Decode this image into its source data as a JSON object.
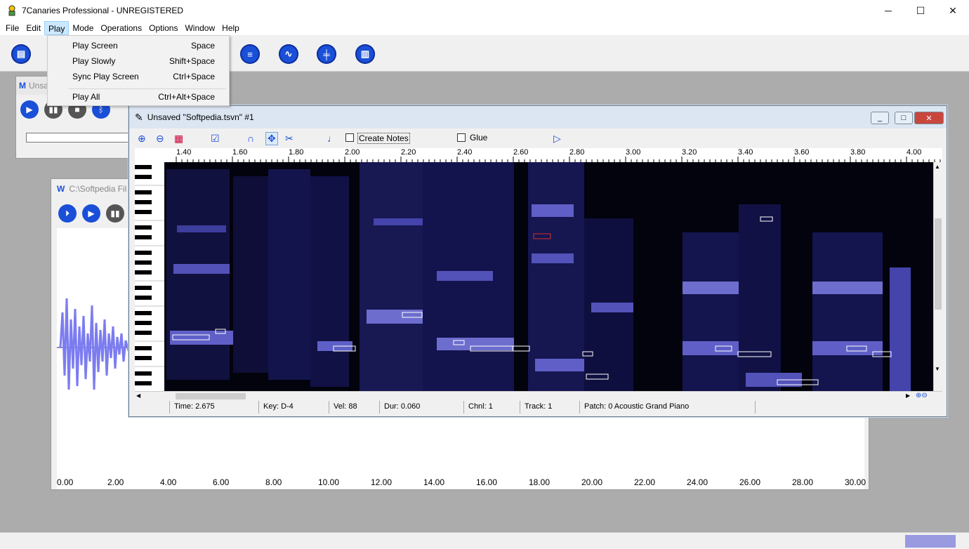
{
  "app": {
    "title": "7Canaries Professional - UNREGISTERED",
    "minimize": "─",
    "maximize": "☐",
    "close": "✕"
  },
  "menu": [
    "File",
    "Edit",
    "Play",
    "Mode",
    "Operations",
    "Options",
    "Window",
    "Help"
  ],
  "play_menu": {
    "items": [
      {
        "label": "Play Screen",
        "shortcut": "Space"
      },
      {
        "label": "Play Slowly",
        "shortcut": "Shift+Space"
      },
      {
        "label": "Sync Play Screen",
        "shortcut": "Ctrl+Space"
      },
      {
        "label": "Play All",
        "shortcut": "Ctrl+Alt+Space"
      }
    ]
  },
  "windows": {
    "back": {
      "title": "Unsa"
    },
    "wave": {
      "title": "C:\\Softpedia Fil",
      "ticks": [
        "0.00",
        "2.00",
        "4.00",
        "6.00",
        "8.00",
        "10.00",
        "12.00",
        "14.00",
        "16.00",
        "18.00",
        "20.00",
        "22.00",
        "24.00",
        "26.00",
        "28.00",
        "30.00"
      ]
    },
    "main": {
      "title": "Unsaved \"Softpedia.tsvn\" #1",
      "create_notes": "Create Notes",
      "glue": "Glue",
      "ruler": [
        "1.40",
        "1.60",
        "1.80",
        "2.00",
        "2.20",
        "2.40",
        "2.60",
        "2.80",
        "3.00",
        "3.20",
        "3.40",
        "3.60",
        "3.80",
        "4.00"
      ],
      "status": {
        "time": "Time: 2.675",
        "key": "Key: D-4",
        "vel": "Vel: 88",
        "dur": "Dur: 0.060",
        "chnl": "Chnl: 1",
        "track": "Track: 1",
        "patch": "Patch: 0 Acoustic Grand Piano"
      }
    }
  },
  "colors": {
    "accent": "#1a4fd8",
    "spectrogram_bg": "#03030d",
    "spectrogram_band": "#7070e8",
    "wave": "#7c7cf0"
  }
}
